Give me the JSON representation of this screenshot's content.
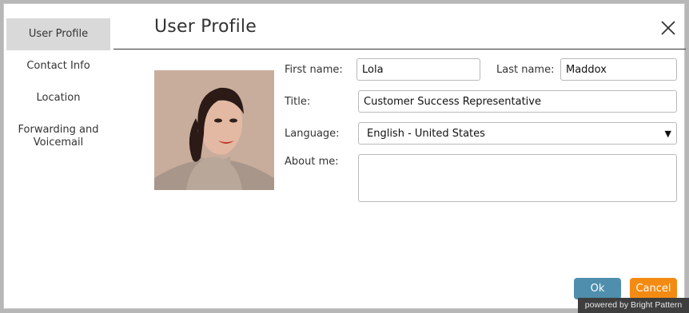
{
  "sidebar": {
    "items": [
      {
        "label": "User Profile",
        "active": true
      },
      {
        "label": "Contact Info"
      },
      {
        "label": "Location"
      },
      {
        "label": "Forwarding and Voicemail"
      }
    ]
  },
  "header": {
    "title": "User Profile",
    "close_icon": "close-icon"
  },
  "form": {
    "first_name": {
      "label": "First name:",
      "value": "Lola"
    },
    "last_name": {
      "label": "Last name:",
      "value": "Maddox"
    },
    "title": {
      "label": "Title:",
      "value": "Customer Success Representative"
    },
    "language": {
      "label": "Language:",
      "value": "English - United States"
    },
    "about": {
      "label": "About me:",
      "value": ""
    }
  },
  "buttons": {
    "ok": "Ok",
    "cancel": "Cancel"
  },
  "footer": {
    "powered": "powered by Bright Pattern"
  },
  "colors": {
    "ok": "#4f8ead",
    "cancel": "#f38b13",
    "active_tab": "#d9d9d9"
  }
}
